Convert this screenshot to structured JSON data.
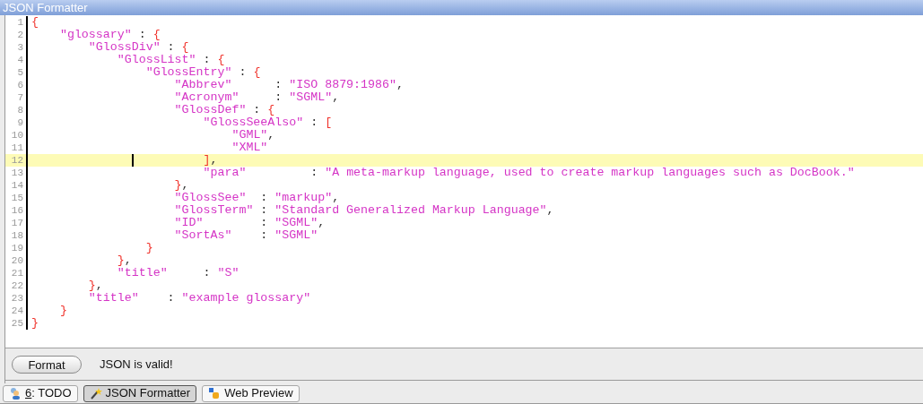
{
  "window": {
    "title": "JSON Formatter"
  },
  "editor": {
    "lines": [
      {
        "number": "1",
        "current": false,
        "tokens": [
          {
            "kind": "brace",
            "text": "{"
          }
        ]
      },
      {
        "number": "2",
        "current": false,
        "tokens": [
          {
            "kind": "key",
            "text": "    \"glossary\""
          },
          {
            "kind": "punct",
            "text": " : "
          },
          {
            "kind": "brace",
            "text": "{"
          }
        ]
      },
      {
        "number": "3",
        "current": false,
        "tokens": [
          {
            "kind": "key",
            "text": "        \"GlossDiv\""
          },
          {
            "kind": "punct",
            "text": " : "
          },
          {
            "kind": "brace",
            "text": "{"
          }
        ]
      },
      {
        "number": "4",
        "current": false,
        "tokens": [
          {
            "kind": "key",
            "text": "            \"GlossList\""
          },
          {
            "kind": "punct",
            "text": " : "
          },
          {
            "kind": "brace",
            "text": "{"
          }
        ]
      },
      {
        "number": "5",
        "current": false,
        "tokens": [
          {
            "kind": "key",
            "text": "                \"GlossEntry\""
          },
          {
            "kind": "punct",
            "text": " : "
          },
          {
            "kind": "brace",
            "text": "{"
          }
        ]
      },
      {
        "number": "6",
        "current": false,
        "tokens": [
          {
            "kind": "key",
            "text": "                    \"Abbrev\""
          },
          {
            "kind": "punct",
            "text": "      : "
          },
          {
            "kind": "string",
            "text": "\"ISO 8879:1986\""
          },
          {
            "kind": "punct",
            "text": ","
          }
        ]
      },
      {
        "number": "7",
        "current": false,
        "tokens": [
          {
            "kind": "key",
            "text": "                    \"Acronym\""
          },
          {
            "kind": "punct",
            "text": "     : "
          },
          {
            "kind": "string",
            "text": "\"SGML\""
          },
          {
            "kind": "punct",
            "text": ","
          }
        ]
      },
      {
        "number": "8",
        "current": false,
        "tokens": [
          {
            "kind": "key",
            "text": "                    \"GlossDef\""
          },
          {
            "kind": "punct",
            "text": " : "
          },
          {
            "kind": "brace",
            "text": "{"
          }
        ]
      },
      {
        "number": "9",
        "current": false,
        "tokens": [
          {
            "kind": "key",
            "text": "                        \"GlossSeeAlso\""
          },
          {
            "kind": "punct",
            "text": " : "
          },
          {
            "kind": "brace",
            "text": "["
          }
        ]
      },
      {
        "number": "10",
        "current": false,
        "tokens": [
          {
            "kind": "string",
            "text": "                            \"GML\""
          },
          {
            "kind": "punct",
            "text": ","
          }
        ]
      },
      {
        "number": "11",
        "current": false,
        "tokens": [
          {
            "kind": "string",
            "text": "                            \"XML\""
          }
        ]
      },
      {
        "number": "12",
        "current": true,
        "tokens": [
          {
            "kind": "brace",
            "text": "                        ]"
          },
          {
            "kind": "punct",
            "text": ","
          }
        ]
      },
      {
        "number": "13",
        "current": false,
        "tokens": [
          {
            "kind": "key",
            "text": "                        \"para\""
          },
          {
            "kind": "punct",
            "text": "         : "
          },
          {
            "kind": "string",
            "text": "\"A meta-markup language, used to create markup languages such as DocBook.\""
          }
        ]
      },
      {
        "number": "14",
        "current": false,
        "tokens": [
          {
            "kind": "brace",
            "text": "                    }"
          },
          {
            "kind": "punct",
            "text": ","
          }
        ]
      },
      {
        "number": "15",
        "current": false,
        "tokens": [
          {
            "kind": "key",
            "text": "                    \"GlossSee\""
          },
          {
            "kind": "punct",
            "text": "  : "
          },
          {
            "kind": "string",
            "text": "\"markup\""
          },
          {
            "kind": "punct",
            "text": ","
          }
        ]
      },
      {
        "number": "16",
        "current": false,
        "tokens": [
          {
            "kind": "key",
            "text": "                    \"GlossTerm\""
          },
          {
            "kind": "punct",
            "text": " : "
          },
          {
            "kind": "string",
            "text": "\"Standard Generalized Markup Language\""
          },
          {
            "kind": "punct",
            "text": ","
          }
        ]
      },
      {
        "number": "17",
        "current": false,
        "tokens": [
          {
            "kind": "key",
            "text": "                    \"ID\""
          },
          {
            "kind": "punct",
            "text": "        : "
          },
          {
            "kind": "string",
            "text": "\"SGML\""
          },
          {
            "kind": "punct",
            "text": ","
          }
        ]
      },
      {
        "number": "18",
        "current": false,
        "tokens": [
          {
            "kind": "key",
            "text": "                    \"SortAs\""
          },
          {
            "kind": "punct",
            "text": "    : "
          },
          {
            "kind": "string",
            "text": "\"SGML\""
          }
        ]
      },
      {
        "number": "19",
        "current": false,
        "tokens": [
          {
            "kind": "brace",
            "text": "                }"
          }
        ]
      },
      {
        "number": "20",
        "current": false,
        "tokens": [
          {
            "kind": "brace",
            "text": "            }"
          },
          {
            "kind": "punct",
            "text": ","
          }
        ]
      },
      {
        "number": "21",
        "current": false,
        "tokens": [
          {
            "kind": "key",
            "text": "            \"title\""
          },
          {
            "kind": "punct",
            "text": "     : "
          },
          {
            "kind": "string",
            "text": "\"S\""
          }
        ]
      },
      {
        "number": "22",
        "current": false,
        "tokens": [
          {
            "kind": "brace",
            "text": "        }"
          },
          {
            "kind": "punct",
            "text": ","
          }
        ]
      },
      {
        "number": "23",
        "current": false,
        "tokens": [
          {
            "kind": "key",
            "text": "        \"title\""
          },
          {
            "kind": "punct",
            "text": "    : "
          },
          {
            "kind": "string",
            "text": "\"example glossary\""
          }
        ]
      },
      {
        "number": "24",
        "current": false,
        "tokens": [
          {
            "kind": "brace",
            "text": "    }"
          }
        ]
      },
      {
        "number": "25",
        "current": false,
        "tokens": [
          {
            "kind": "brace",
            "text": "}"
          }
        ]
      }
    ]
  },
  "actions": {
    "button": "Format",
    "status": "JSON is valid!"
  },
  "tool_tabs": [
    {
      "kind": "todo",
      "mnemonic": "6",
      "label": ": TODO",
      "selected": false
    },
    {
      "kind": "wand",
      "label": "JSON Formatter",
      "selected": true
    },
    {
      "kind": "web",
      "label": "Web Preview",
      "selected": false
    }
  ]
}
